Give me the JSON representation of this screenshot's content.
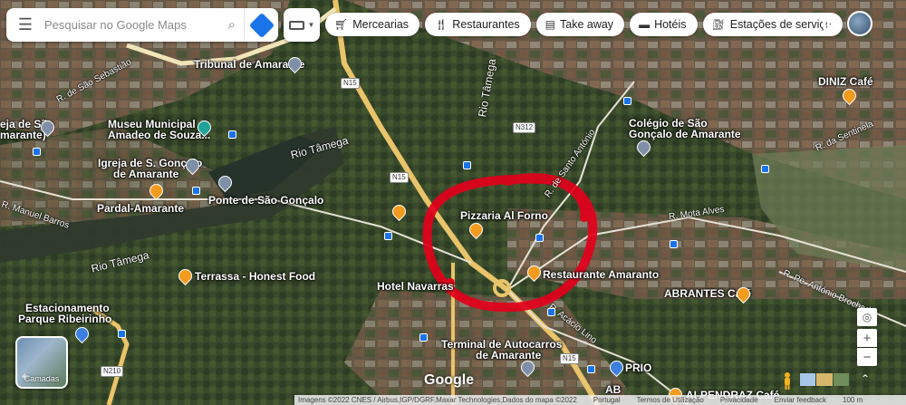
{
  "search": {
    "placeholder": "Pesquisar no Google Maps",
    "menu_icon": "menu-icon",
    "search_icon": "search-icon",
    "directions_icon": "directions-icon"
  },
  "chips": [
    {
      "label": "Mercearias",
      "icon": "cart-icon"
    },
    {
      "label": "Restaurantes",
      "icon": "fork-knife-icon"
    },
    {
      "label": "Take away",
      "icon": "takeaway-bag-icon"
    },
    {
      "label": "Hotéis",
      "icon": "bed-icon"
    },
    {
      "label": "Estações de serviço",
      "icon": "fuel-pump-icon"
    }
  ],
  "places": {
    "tribunal": "Tribunal de Amarante",
    "museu1": "Museu Municipal",
    "museu2": "Amadeo de Souza...",
    "igreja1": "Igreja de S. Gonçalo",
    "igreja2": "de Amarante",
    "igreja_sao1": "eja de São",
    "igreja_sao2": "marante)",
    "pardal": "Pardal-Amarante",
    "ponte": "Ponte de São Gonçalo",
    "terrassa": "Terrassa - Honest Food",
    "estacionamento1": "Estacionamento",
    "estacionamento2": "Parque Ribeirinho",
    "hotel": "Hotel Navarras",
    "pizzaria": "Pizzaria Al Forno",
    "restaurante": "Restaurante Amaranto",
    "colegio1": "Colégio de São",
    "colegio2": "Gonçalo de Amarante",
    "diniz": "DINIZ Café",
    "abrantes": "ABRANTES Café",
    "terminal1": "Terminal de Autocarros",
    "terminal2": "de Amarante",
    "prio": "PRIO",
    "ab": "AB",
    "alpendr": "ALPENDRAZ Café"
  },
  "roads": {
    "sebastiao": "R. de São Sebastião",
    "rio1": "Rio Tâmega",
    "rio2": "Rio Tâmega",
    "rio3": "Rio Tâmega",
    "manuel": "R. Manuel Barros",
    "santo_antonio": "R. de Santo António",
    "mota": "R. Mota Alves",
    "sentinela": "R. da Sentinela",
    "pe_antonio": "R. Pe. António Brochado",
    "acacio": "R. Acácio Lino",
    "n15a": "N15",
    "n15b": "N15",
    "n15c": "N15",
    "n312": "N312",
    "n210": "N210"
  },
  "controls": {
    "camadas": "Camadas",
    "zoom_in": "+",
    "zoom_out": "−",
    "locate_icon": "my-location-icon",
    "pegman_icon": "pegman-icon",
    "expand_icon": "expand-icon"
  },
  "footer": {
    "google": "Google",
    "imagens": "Imagens ©2022 CNES / Airbus,IGP/DGRF,Maxar Technologies,Dados do mapa ©2022",
    "portugal": "Portugal",
    "termos": "Termos de Utilização",
    "privacidade": "Privacidade",
    "feedback": "Enviar feedback",
    "scale": "100 m"
  },
  "colors": {
    "accent": "#1a73e8",
    "annotation": "#e3001b",
    "food_pin": "#f29b1e"
  }
}
